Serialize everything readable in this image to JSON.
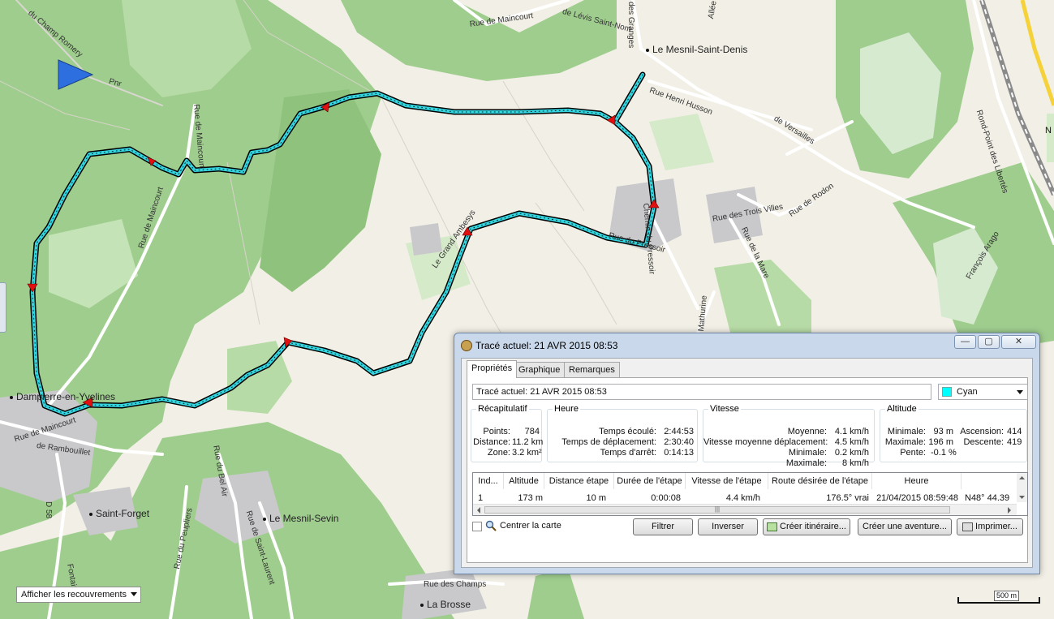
{
  "map": {
    "labels": {
      "l1": "du Champ Romery",
      "l2": "Pnr",
      "l3": "Rue de Maincourt",
      "l4": "de Lévis Saint-Nom",
      "l5": "des Granges",
      "l6": "Allée des",
      "l7": "Le Mesnil-Saint-Denis",
      "l8": "Rue Henri Husson",
      "l9": "de Versailles",
      "l10": "Rond-Point des Libertés",
      "l11": "Rue de Maincourt",
      "l12": "Rue de Maincourt",
      "l13": "Le Grand Ambesys",
      "l14": "Chemin du Pressoir",
      "l15": "Rue du Pressoir",
      "l16": "Rue des Trois Villes",
      "l17": "Rue de Rodon",
      "l18": "Rue de la Mare",
      "l19": "François Arago",
      "l20": "Mathurine",
      "l21": "Dampierre-en-Yvelines",
      "l22": "Rue de Maincourt",
      "l23": "de Rambouillet",
      "l24": "D 58",
      "l25": "Saint-Forget",
      "l26": "Rue du Bel Air",
      "l27": "Le Mesnil-Sevin",
      "l28": "Rue de Saint-Laurent",
      "l29": "Rue du Peupliers",
      "l30": "Rue des Champs",
      "l31": "La Brosse",
      "l32": "Fontaines",
      "l33": "N"
    },
    "overlay_combo": "Afficher les recouvrements",
    "scale_label": "500 m",
    "track_color": "#33d6e0",
    "forest_color": "#9bcb8a"
  },
  "dialog": {
    "title": "Tracé actuel: 21 AVR 2015 08:53",
    "window_buttons": {
      "min": "—",
      "max": "▢",
      "close": "✕"
    },
    "tabs": [
      "Propriétés",
      "Graphique",
      "Remarques"
    ],
    "name_value": "Tracé actuel: 21 AVR 2015 08:53",
    "color": {
      "label": "Cyan",
      "hex": "#00ffff"
    },
    "summary": {
      "legend": "Récapitulatif",
      "points_label": "Points:",
      "points": "784",
      "distance_label": "Distance:",
      "distance": "11.2 km",
      "zone_label": "Zone:",
      "zone": "3.2 km²"
    },
    "time": {
      "legend": "Heure",
      "elapsed_label": "Temps écoulé:",
      "elapsed": "2:44:53",
      "moving_label": "Temps de déplacement:",
      "moving": "2:30:40",
      "stopped_label": "Temps d'arrêt:",
      "stopped": "0:14:13"
    },
    "speed": {
      "legend": "Vitesse",
      "avg_label": "Moyenne:",
      "avg": "4.1 km/h",
      "moving_avg_label": "Vitesse moyenne déplacement:",
      "moving_avg": "4.5 km/h",
      "min_label": "Minimale:",
      "min": "0.2 km/h",
      "max_label": "Maximale:",
      "max": "8 km/h"
    },
    "altitude": {
      "legend": "Altitude",
      "min_label": "Minimale:",
      "min": "93 m",
      "max_label": "Maximale:",
      "max": "196 m",
      "slope_label": "Pente:",
      "slope": "-0.1 %",
      "ascent_label": "Ascension:",
      "ascent": "414",
      "descent_label": "Descente:",
      "descent": "419"
    },
    "table": {
      "headers": [
        "Ind...",
        "Altitude",
        "Distance étape",
        "Durée de l'étape",
        "Vitesse de l'étape",
        "Route désirée de l'étape",
        "Heure"
      ],
      "row": {
        "ind": "1",
        "altitude": "173 m",
        "distance": "10 m",
        "duration": "0:00:08",
        "speed": "4.4 km/h",
        "course": "176.5° vrai",
        "time": "21/04/2015 08:59:48",
        "position": "N48° 44.39"
      }
    },
    "center_map_label": "Centrer la carte",
    "buttons": {
      "filter": "Filtrer",
      "reverse": "Inverser",
      "create_route": "Créer itinéraire...",
      "create_adventure": "Créer une aventure...",
      "print": "Imprimer..."
    }
  }
}
